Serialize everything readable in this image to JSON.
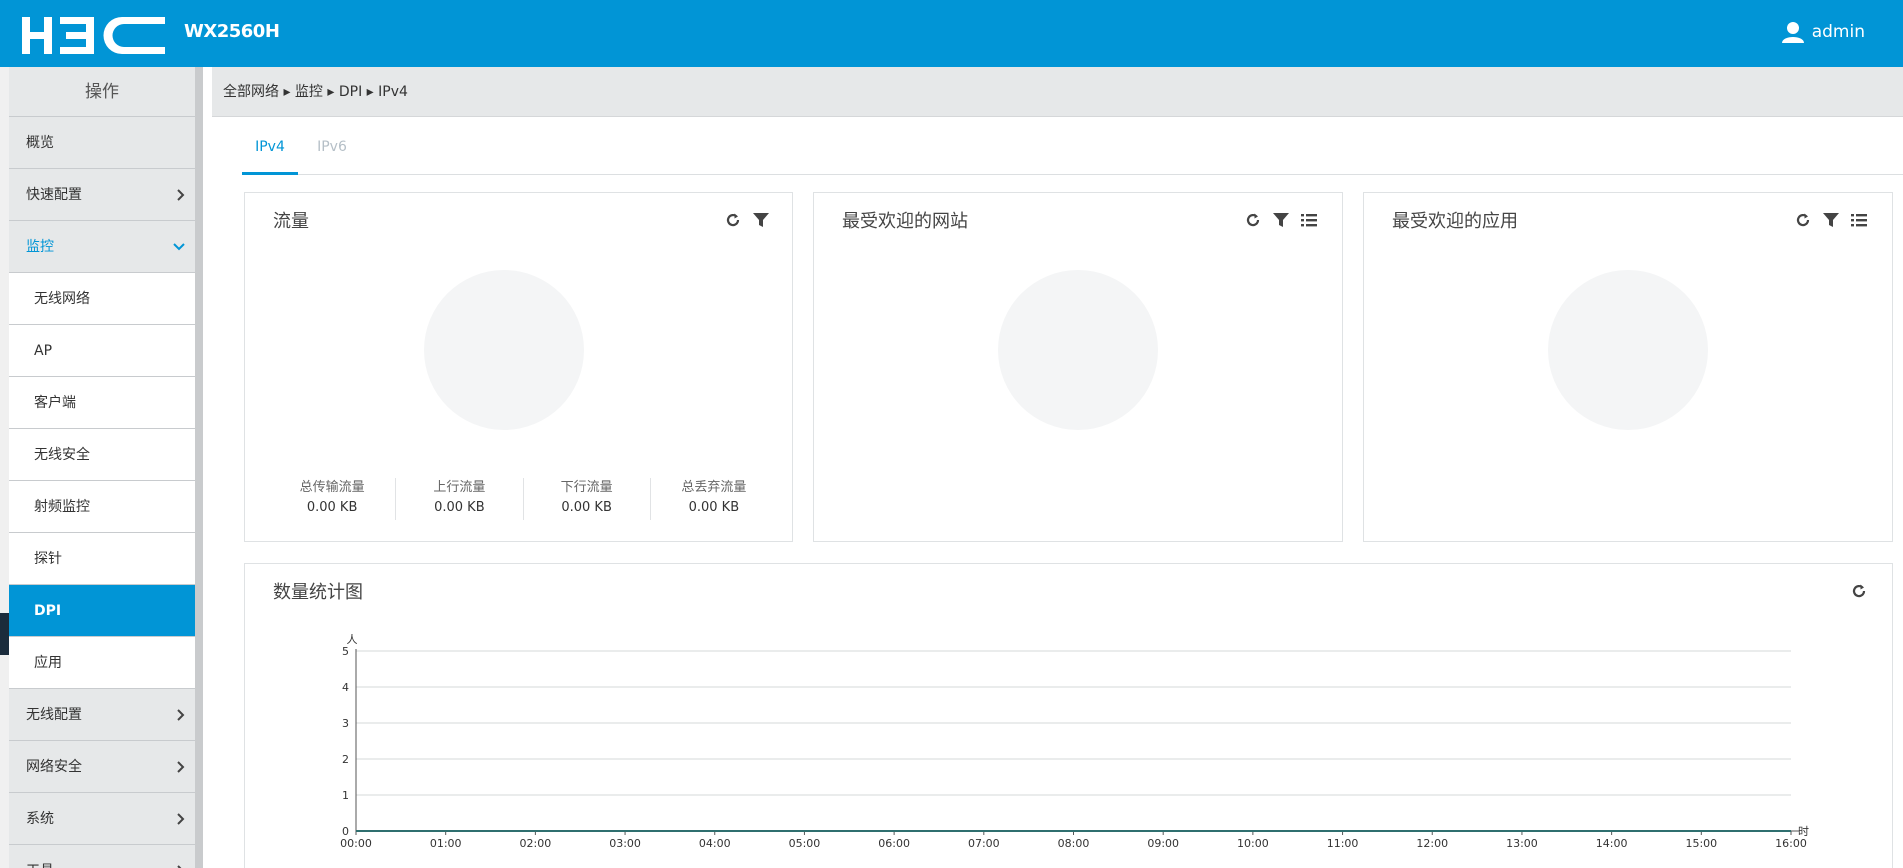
{
  "header": {
    "logo_text": "H3C",
    "model": "WX2560H",
    "user": "admin",
    "brand_color": "#0195d6"
  },
  "sidebar": {
    "title": "操作",
    "items": [
      {
        "label": "概览",
        "chevron": ""
      },
      {
        "label": "快速配置",
        "chevron": "›"
      },
      {
        "label": "监控",
        "chevron": "⌄",
        "expanded": true
      }
    ],
    "subitems": [
      {
        "label": "无线网络"
      },
      {
        "label": "AP"
      },
      {
        "label": "客户端"
      },
      {
        "label": "无线安全"
      },
      {
        "label": "射频监控"
      },
      {
        "label": "探针"
      },
      {
        "label": "DPI",
        "selected": true
      },
      {
        "label": "应用"
      }
    ],
    "bottom_items": [
      {
        "label": "无线配置",
        "chevron": "›"
      },
      {
        "label": "网络安全",
        "chevron": "›"
      },
      {
        "label": "系统",
        "chevron": "›"
      },
      {
        "label": "工具",
        "chevron": "›"
      }
    ]
  },
  "breadcrumb": "全部网络 ▸ 监控 ▸ DPI ▸ IPv4",
  "tabs": [
    {
      "label": "IPv4",
      "active": true
    },
    {
      "label": "IPv6",
      "active": false
    }
  ],
  "cards": {
    "traffic": {
      "title": "流量",
      "stats": [
        {
          "label": "总传输流量",
          "value": "0.00 KB"
        },
        {
          "label": "上行流量",
          "value": "0.00 KB"
        },
        {
          "label": "下行流量",
          "value": "0.00 KB"
        },
        {
          "label": "总丢弃流量",
          "value": "0.00 KB"
        }
      ]
    },
    "sites": {
      "title": "最受欢迎的网站"
    },
    "apps": {
      "title": "最受欢迎的应用"
    },
    "count_chart": {
      "title": "数量统计图"
    }
  },
  "chart_data": {
    "type": "line",
    "title": "数量统计图",
    "ylabel": "人",
    "xlabel": "时",
    "x": [
      "00:00",
      "01:00",
      "02:00",
      "03:00",
      "04:00",
      "05:00",
      "06:00",
      "07:00",
      "08:00",
      "09:00",
      "10:00",
      "11:00",
      "12:00",
      "13:00",
      "14:00",
      "15:00",
      "16:00"
    ],
    "y_ticks": [
      0,
      1,
      2,
      3,
      4,
      5
    ],
    "ylim": [
      0,
      5
    ],
    "series": [
      {
        "values": [
          0,
          0,
          0,
          0,
          0,
          0,
          0,
          0,
          0,
          0,
          0,
          0,
          0,
          0,
          0,
          0,
          0
        ],
        "color": "#2f6f6f"
      }
    ],
    "grid": true
  }
}
